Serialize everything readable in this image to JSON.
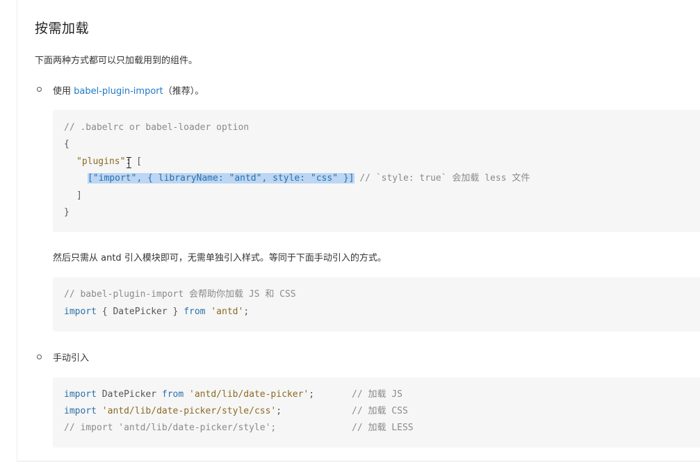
{
  "heading": "按需加载",
  "intro": "下面两种方式都可以只加载用到的组件。",
  "option1": {
    "prefix": "使用 ",
    "link": "babel-plugin-import",
    "suffix": "（推荐）。"
  },
  "code1": {
    "line1": "// .babelrc or babel-loader option",
    "line2": "{",
    "line3_key": "\"plugins\"",
    "line3_rest": ": [",
    "line4_selected": "[\"import\", { libraryName: \"antd\", style: \"css\" }]",
    "line4_comment": " // `style: true` 会加载 less 文件",
    "line5": "]",
    "line6": "}"
  },
  "paragraph": "然后只需从 antd 引入模块即可，无需单独引入样式。等同于下面手动引入的方式。",
  "code2": {
    "line1": "// babel-plugin-import 会帮助你加载 JS 和 CSS",
    "line2_kw1": "import",
    "line2_mid": " { DatePicker } ",
    "line2_kw2": "from",
    "line2_sp": " ",
    "line2_str": "'antd'",
    "line2_end": ";"
  },
  "option2": {
    "label": "手动引入"
  },
  "code3": {
    "l1_kw1": "import",
    "l1_mid": " DatePicker ",
    "l1_kw2": "from",
    "l1_sp": " ",
    "l1_str": "'antd/lib/date-picker'",
    "l1_end": ";",
    "l1_comment": "// 加载 JS",
    "l2_kw": "import",
    "l2_sp": " ",
    "l2_str": "'antd/lib/date-picker/style/css'",
    "l2_end": ";",
    "l2_comment": "// 加载 CSS",
    "l3": "// import 'antd/lib/date-picker/style';",
    "l3_comment": "// 加载 LESS"
  }
}
